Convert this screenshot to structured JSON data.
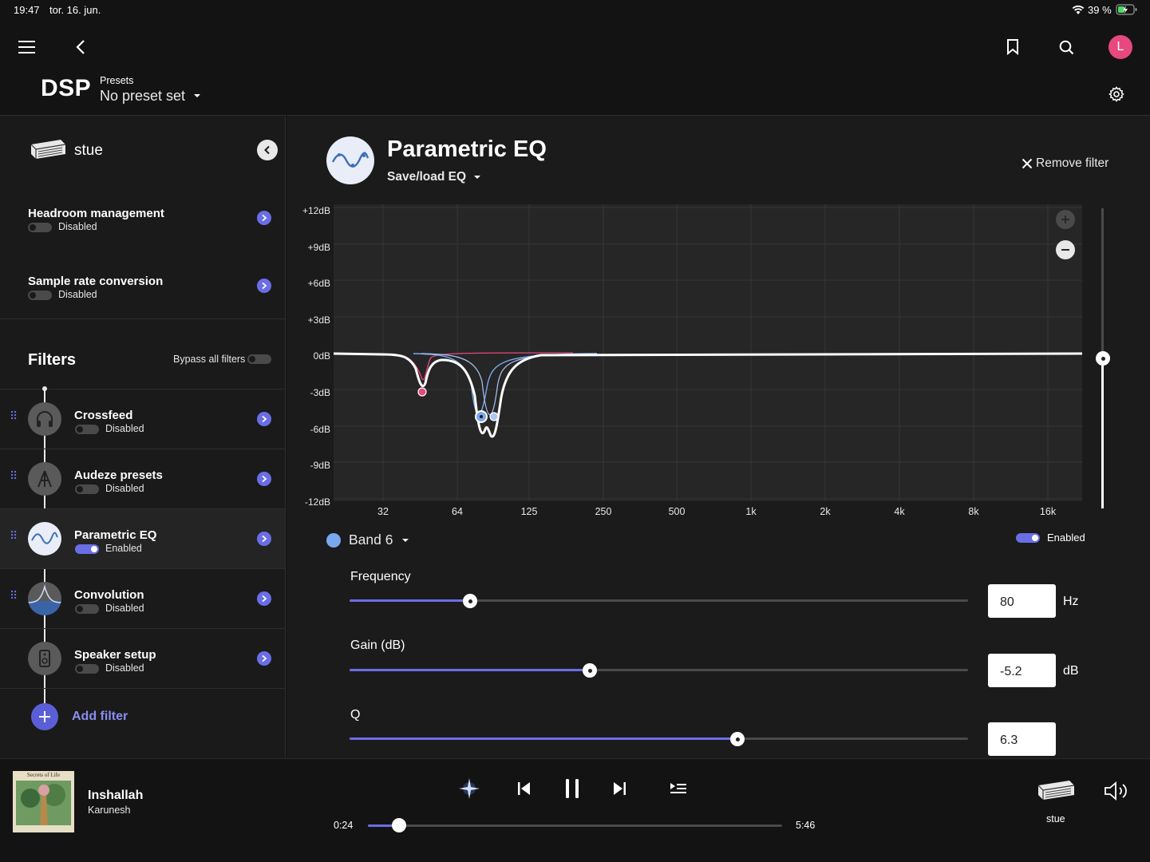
{
  "status_bar": {
    "time": "19:47",
    "date": "tor. 16. jun.",
    "battery": "39 %"
  },
  "header": {
    "title": "DSP",
    "presets_label": "Presets",
    "preset_value": "No preset set",
    "avatar_letter": "L"
  },
  "sidebar": {
    "device_name": "stue",
    "headroom": {
      "title": "Headroom management",
      "status": "Disabled"
    },
    "sample_rate": {
      "title": "Sample rate conversion",
      "status": "Disabled"
    },
    "filters_title": "Filters",
    "bypass_label": "Bypass all filters",
    "filters": [
      {
        "name": "Crossfeed",
        "status": "Disabled",
        "enabled": false,
        "icon": "headphones-icon"
      },
      {
        "name": "Audeze presets",
        "status": "Disabled",
        "enabled": false,
        "icon": "audeze-logo-icon"
      },
      {
        "name": "Parametric EQ",
        "status": "Enabled",
        "enabled": true,
        "icon": "eq-wave-icon"
      },
      {
        "name": "Convolution",
        "status": "Disabled",
        "enabled": false,
        "icon": "convolution-icon"
      },
      {
        "name": "Speaker setup",
        "status": "Disabled",
        "enabled": false,
        "icon": "speaker-icon"
      }
    ],
    "add_filter_label": "Add filter"
  },
  "main": {
    "title": "Parametric EQ",
    "save_load_label": "Save/load EQ",
    "remove_filter_label": "Remove filter",
    "graph": {
      "y_labels": [
        "+12dB",
        "+9dB",
        "+6dB",
        "+3dB",
        "0dB",
        "-3dB",
        "-6dB",
        "-9dB",
        "-12dB"
      ],
      "x_labels": [
        "32",
        "64",
        "125",
        "250",
        "500",
        "1k",
        "2k",
        "4k",
        "8k",
        "16k"
      ]
    },
    "band": {
      "label": "Band 6",
      "enabled_label": "Enabled",
      "color": "#7aa8ee"
    },
    "frequency": {
      "label": "Frequency",
      "value": "80",
      "unit": "Hz",
      "fraction": 0.195
    },
    "gain": {
      "label": "Gain (dB)",
      "value": "-5.2",
      "unit": "dB",
      "fraction": 0.388
    },
    "q": {
      "label": "Q",
      "value": "6.3",
      "fraction": 0.627
    }
  },
  "player": {
    "album_text": "Secrets of Life",
    "track": "Inshallah",
    "artist": "Karunesh",
    "elapsed": "0:24",
    "duration": "5:46",
    "progress_fraction": 0.075,
    "device": "stue"
  },
  "colors": {
    "accent": "#6a6ee6",
    "pink": "#e7487f",
    "band_blue": "#7aa8ee"
  }
}
